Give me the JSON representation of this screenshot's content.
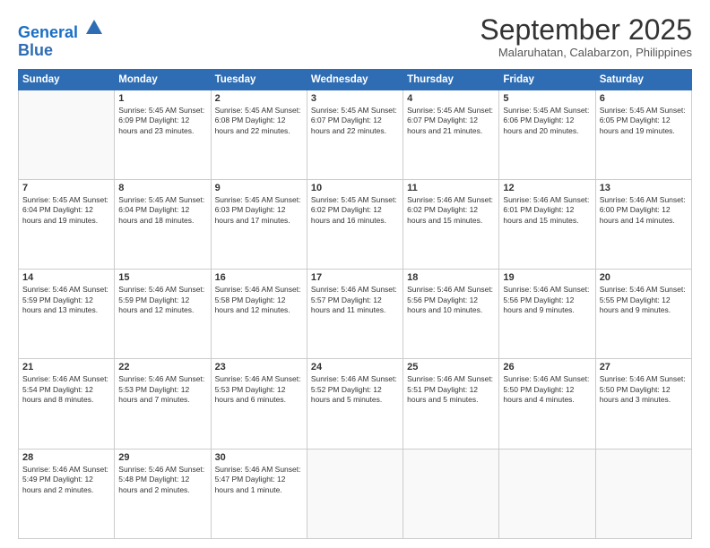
{
  "header": {
    "logo_line1": "General",
    "logo_line2": "Blue",
    "month": "September 2025",
    "location": "Malaruhatan, Calabarzon, Philippines"
  },
  "weekdays": [
    "Sunday",
    "Monday",
    "Tuesday",
    "Wednesday",
    "Thursday",
    "Friday",
    "Saturday"
  ],
  "weeks": [
    [
      {
        "day": "",
        "info": ""
      },
      {
        "day": "1",
        "info": "Sunrise: 5:45 AM\nSunset: 6:09 PM\nDaylight: 12 hours\nand 23 minutes."
      },
      {
        "day": "2",
        "info": "Sunrise: 5:45 AM\nSunset: 6:08 PM\nDaylight: 12 hours\nand 22 minutes."
      },
      {
        "day": "3",
        "info": "Sunrise: 5:45 AM\nSunset: 6:07 PM\nDaylight: 12 hours\nand 22 minutes."
      },
      {
        "day": "4",
        "info": "Sunrise: 5:45 AM\nSunset: 6:07 PM\nDaylight: 12 hours\nand 21 minutes."
      },
      {
        "day": "5",
        "info": "Sunrise: 5:45 AM\nSunset: 6:06 PM\nDaylight: 12 hours\nand 20 minutes."
      },
      {
        "day": "6",
        "info": "Sunrise: 5:45 AM\nSunset: 6:05 PM\nDaylight: 12 hours\nand 19 minutes."
      }
    ],
    [
      {
        "day": "7",
        "info": "Sunrise: 5:45 AM\nSunset: 6:04 PM\nDaylight: 12 hours\nand 19 minutes."
      },
      {
        "day": "8",
        "info": "Sunrise: 5:45 AM\nSunset: 6:04 PM\nDaylight: 12 hours\nand 18 minutes."
      },
      {
        "day": "9",
        "info": "Sunrise: 5:45 AM\nSunset: 6:03 PM\nDaylight: 12 hours\nand 17 minutes."
      },
      {
        "day": "10",
        "info": "Sunrise: 5:45 AM\nSunset: 6:02 PM\nDaylight: 12 hours\nand 16 minutes."
      },
      {
        "day": "11",
        "info": "Sunrise: 5:46 AM\nSunset: 6:02 PM\nDaylight: 12 hours\nand 15 minutes."
      },
      {
        "day": "12",
        "info": "Sunrise: 5:46 AM\nSunset: 6:01 PM\nDaylight: 12 hours\nand 15 minutes."
      },
      {
        "day": "13",
        "info": "Sunrise: 5:46 AM\nSunset: 6:00 PM\nDaylight: 12 hours\nand 14 minutes."
      }
    ],
    [
      {
        "day": "14",
        "info": "Sunrise: 5:46 AM\nSunset: 5:59 PM\nDaylight: 12 hours\nand 13 minutes."
      },
      {
        "day": "15",
        "info": "Sunrise: 5:46 AM\nSunset: 5:59 PM\nDaylight: 12 hours\nand 12 minutes."
      },
      {
        "day": "16",
        "info": "Sunrise: 5:46 AM\nSunset: 5:58 PM\nDaylight: 12 hours\nand 12 minutes."
      },
      {
        "day": "17",
        "info": "Sunrise: 5:46 AM\nSunset: 5:57 PM\nDaylight: 12 hours\nand 11 minutes."
      },
      {
        "day": "18",
        "info": "Sunrise: 5:46 AM\nSunset: 5:56 PM\nDaylight: 12 hours\nand 10 minutes."
      },
      {
        "day": "19",
        "info": "Sunrise: 5:46 AM\nSunset: 5:56 PM\nDaylight: 12 hours\nand 9 minutes."
      },
      {
        "day": "20",
        "info": "Sunrise: 5:46 AM\nSunset: 5:55 PM\nDaylight: 12 hours\nand 9 minutes."
      }
    ],
    [
      {
        "day": "21",
        "info": "Sunrise: 5:46 AM\nSunset: 5:54 PM\nDaylight: 12 hours\nand 8 minutes."
      },
      {
        "day": "22",
        "info": "Sunrise: 5:46 AM\nSunset: 5:53 PM\nDaylight: 12 hours\nand 7 minutes."
      },
      {
        "day": "23",
        "info": "Sunrise: 5:46 AM\nSunset: 5:53 PM\nDaylight: 12 hours\nand 6 minutes."
      },
      {
        "day": "24",
        "info": "Sunrise: 5:46 AM\nSunset: 5:52 PM\nDaylight: 12 hours\nand 5 minutes."
      },
      {
        "day": "25",
        "info": "Sunrise: 5:46 AM\nSunset: 5:51 PM\nDaylight: 12 hours\nand 5 minutes."
      },
      {
        "day": "26",
        "info": "Sunrise: 5:46 AM\nSunset: 5:50 PM\nDaylight: 12 hours\nand 4 minutes."
      },
      {
        "day": "27",
        "info": "Sunrise: 5:46 AM\nSunset: 5:50 PM\nDaylight: 12 hours\nand 3 minutes."
      }
    ],
    [
      {
        "day": "28",
        "info": "Sunrise: 5:46 AM\nSunset: 5:49 PM\nDaylight: 12 hours\nand 2 minutes."
      },
      {
        "day": "29",
        "info": "Sunrise: 5:46 AM\nSunset: 5:48 PM\nDaylight: 12 hours\nand 2 minutes."
      },
      {
        "day": "30",
        "info": "Sunrise: 5:46 AM\nSunset: 5:47 PM\nDaylight: 12 hours\nand 1 minute."
      },
      {
        "day": "",
        "info": ""
      },
      {
        "day": "",
        "info": ""
      },
      {
        "day": "",
        "info": ""
      },
      {
        "day": "",
        "info": ""
      }
    ]
  ]
}
